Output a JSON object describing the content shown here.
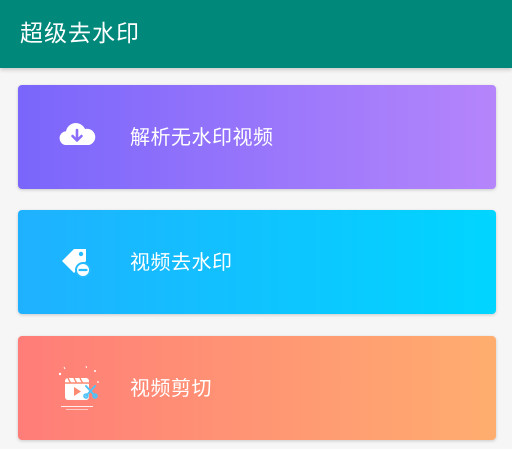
{
  "app": {
    "title": "超级去水印"
  },
  "menu": {
    "items": [
      {
        "label": "解析无水印视频",
        "icon": "cloud-download-icon",
        "gradient": [
          "#7a66fb",
          "#b585fb"
        ]
      },
      {
        "label": "视频去水印",
        "icon": "tag-remove-icon",
        "gradient": [
          "#1fb1ff",
          "#00d5ff"
        ]
      },
      {
        "label": "视频剪切",
        "icon": "video-scissors-icon",
        "gradient": [
          "#ff7d78",
          "#ffad6f"
        ]
      }
    ]
  },
  "colors": {
    "appbar": "#00897b",
    "background": "#f6f6f6"
  }
}
